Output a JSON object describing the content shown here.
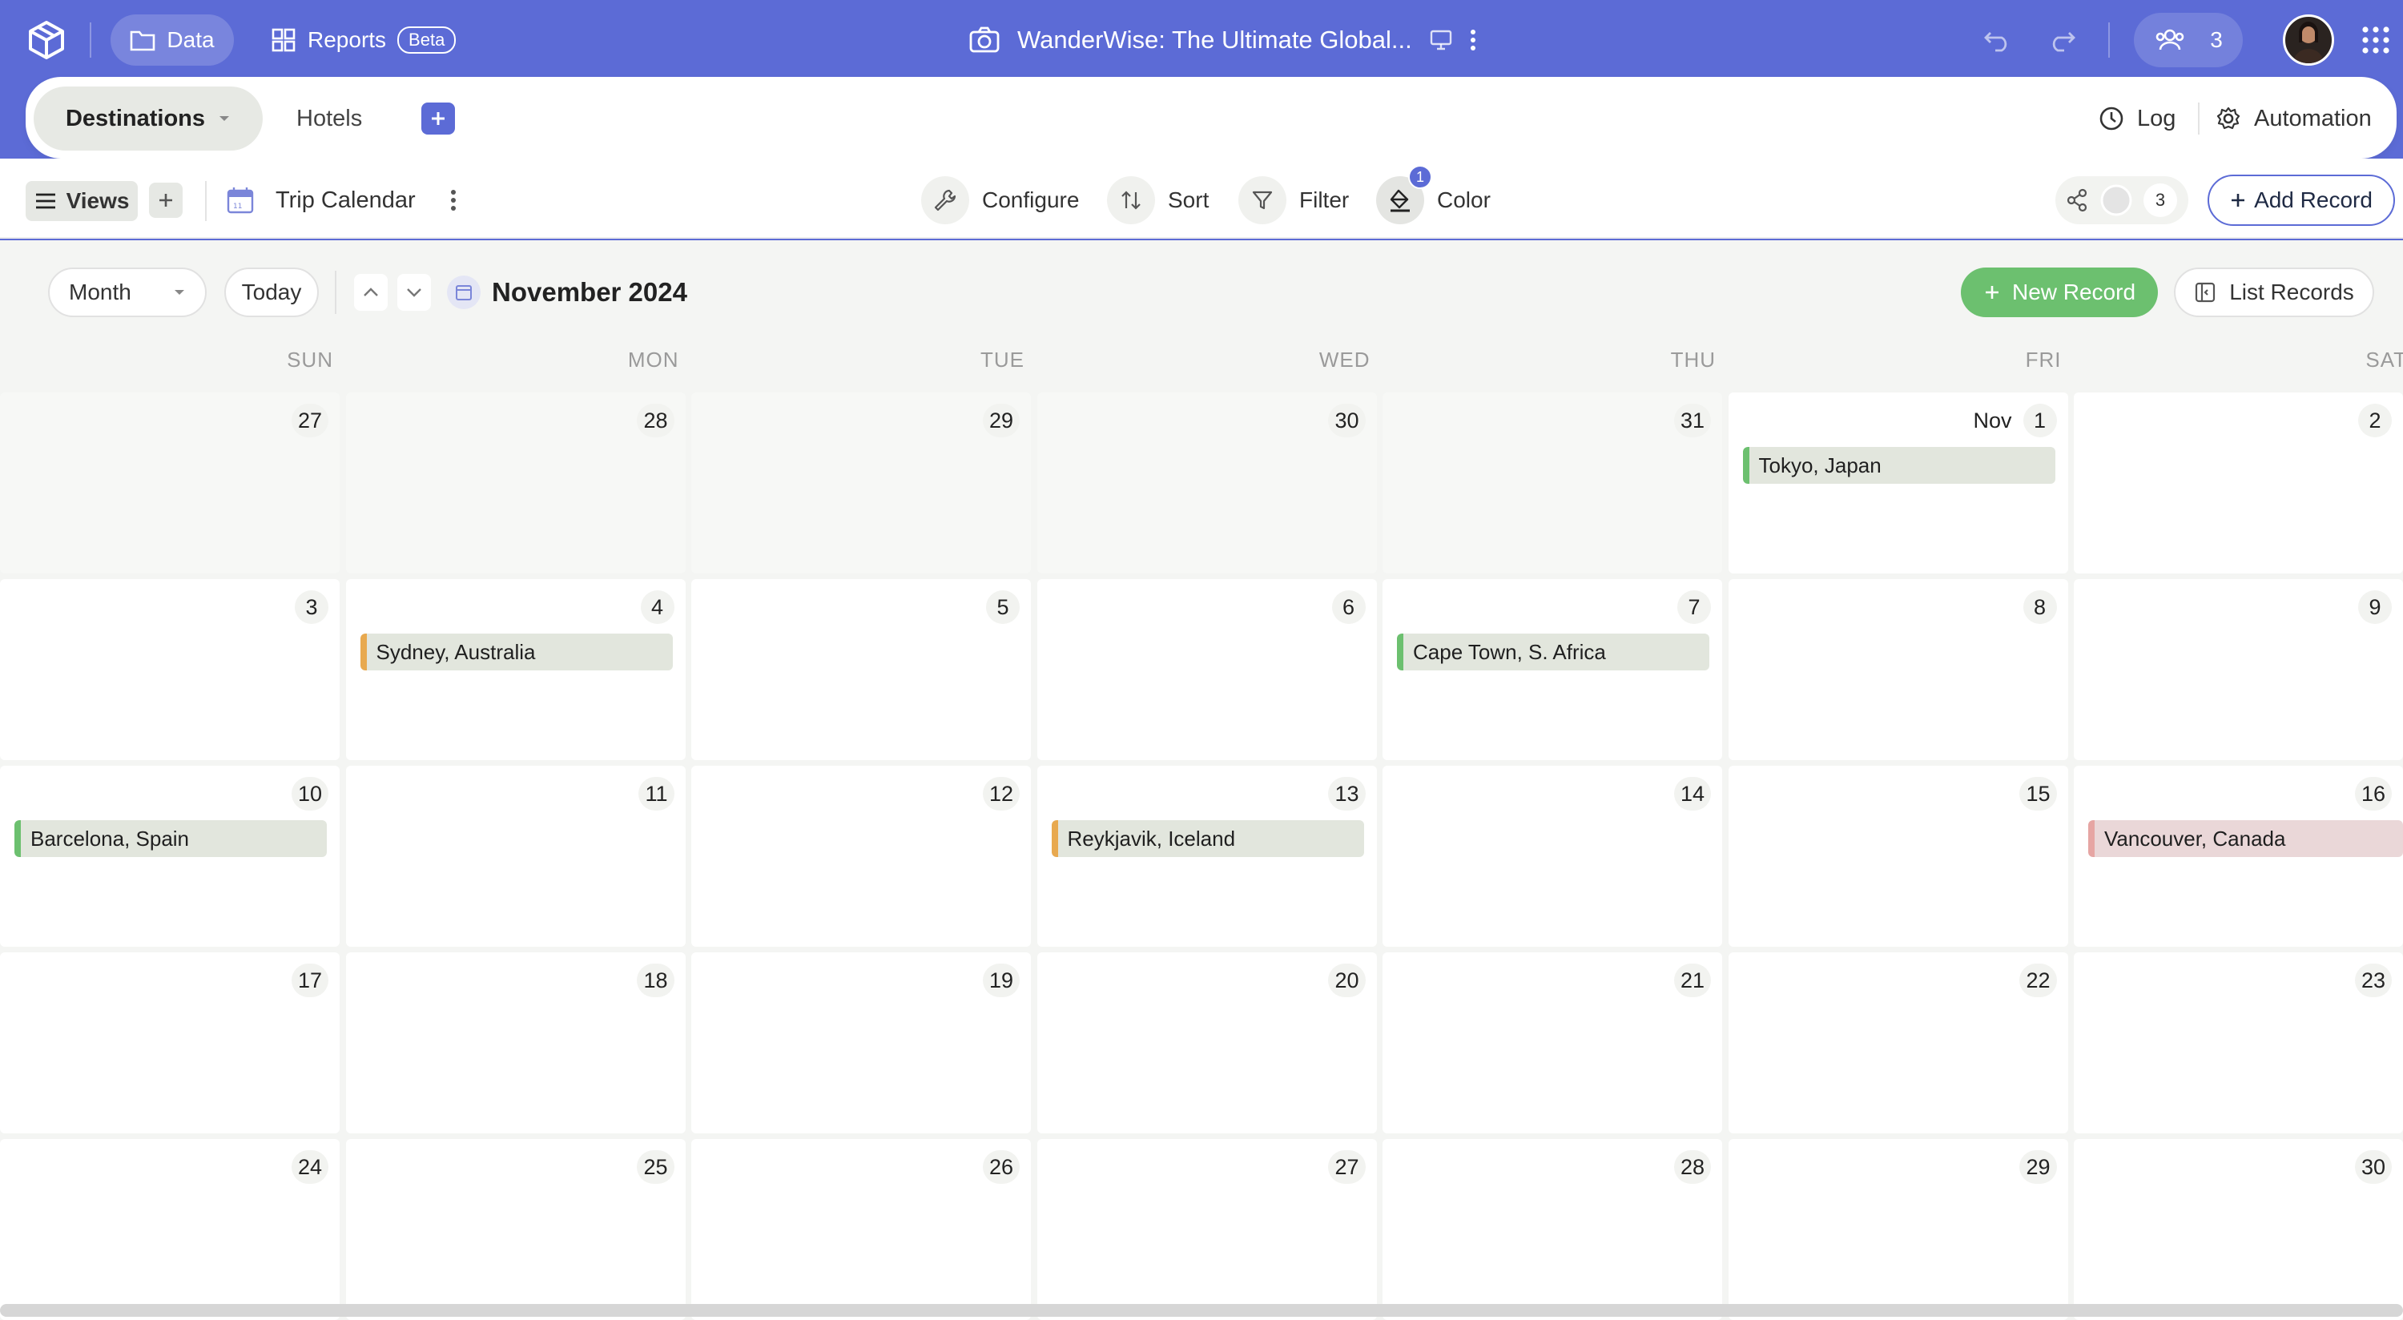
{
  "topbar": {
    "data_label": "Data",
    "reports_label": "Reports",
    "beta_label": "Beta",
    "base_title": "WanderWise: The Ultimate Global...",
    "collaborator_count": "3"
  },
  "tabs": {
    "active": "Destinations",
    "hotels": "Hotels",
    "log": "Log",
    "automation": "Automation"
  },
  "toolbar": {
    "views": "Views",
    "view_name": "Trip Calendar",
    "configure": "Configure",
    "sort": "Sort",
    "filter": "Filter",
    "color": "Color",
    "color_badge": "1",
    "share_count": "3",
    "add_record": "Add Record"
  },
  "calendar": {
    "mode": "Month",
    "today": "Today",
    "current_month": "November 2024",
    "new_record": "New Record",
    "list_records": "List Records",
    "weekdays": [
      "SUN",
      "MON",
      "TUE",
      "WED",
      "THU",
      "FRI",
      "SAT"
    ],
    "weeks": [
      [
        {
          "d": "27",
          "out": true
        },
        {
          "d": "28",
          "out": true
        },
        {
          "d": "29",
          "out": true
        },
        {
          "d": "30",
          "out": true
        },
        {
          "d": "31",
          "out": true
        },
        {
          "d": "1",
          "mon": "Nov",
          "event": "Tokyo, Japan",
          "color": "#6cc06f"
        },
        {
          "d": "2"
        }
      ],
      [
        {
          "d": "3"
        },
        {
          "d": "4",
          "event": "Sydney, Australia",
          "color": "#e8a94f"
        },
        {
          "d": "5"
        },
        {
          "d": "6"
        },
        {
          "d": "7",
          "event": "Cape Town, S. Africa",
          "color": "#6cc06f"
        },
        {
          "d": "8"
        },
        {
          "d": "9"
        }
      ],
      [
        {
          "d": "10",
          "event": "Barcelona, Spain",
          "color": "#6cc06f"
        },
        {
          "d": "11"
        },
        {
          "d": "12"
        },
        {
          "d": "13",
          "event": "Reykjavik, Iceland",
          "color": "#e8a94f"
        },
        {
          "d": "14"
        },
        {
          "d": "15"
        },
        {
          "d": "16",
          "event": "Vancouver, Canada",
          "color": "#e6a5a3",
          "pink": true
        }
      ],
      [
        {
          "d": "17"
        },
        {
          "d": "18"
        },
        {
          "d": "19"
        },
        {
          "d": "20"
        },
        {
          "d": "21"
        },
        {
          "d": "22"
        },
        {
          "d": "23"
        }
      ],
      [
        {
          "d": "24"
        },
        {
          "d": "25"
        },
        {
          "d": "26"
        },
        {
          "d": "27"
        },
        {
          "d": "28"
        },
        {
          "d": "29"
        },
        {
          "d": "30"
        }
      ]
    ]
  },
  "colors": {
    "accent": "#5c6bd6",
    "success": "#6cc06f",
    "warning": "#e8a94f"
  }
}
